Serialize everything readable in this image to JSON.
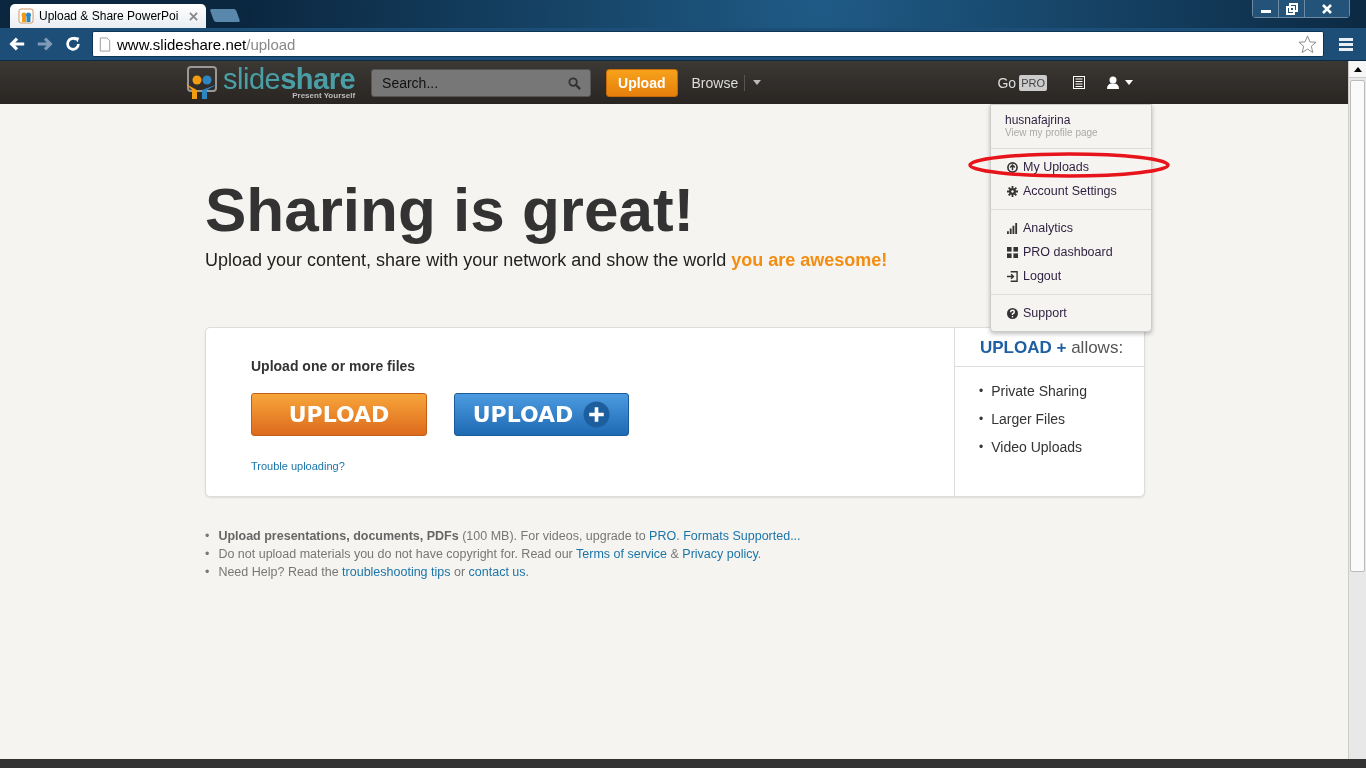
{
  "browser": {
    "tab_title": "Upload & Share PowerPoi",
    "url_host": "www.slideshare.net",
    "url_path": "/upload"
  },
  "header": {
    "logo_text": "slide**share**",
    "logo_tagline": "Present Yourself",
    "search": {
      "placeholder": "Search..."
    },
    "upload_button": "Upload",
    "browse": "Browse",
    "go": "Go",
    "pro_badge": "PRO"
  },
  "user_menu": {
    "username": "husnafajrina",
    "profile_link": "View my profile page",
    "groups": [
      [
        {
          "label": "My Uploads",
          "kind": "upload",
          "circled": true
        },
        {
          "label": "Account Settings",
          "kind": "gear",
          "circled": false
        }
      ],
      [
        {
          "label": "Analytics",
          "kind": "bars",
          "circled": false
        },
        {
          "label": "PRO dashboard",
          "kind": "grid",
          "circled": false
        },
        {
          "label": "Logout",
          "kind": "logout",
          "circled": false
        }
      ],
      [
        {
          "label": "Support",
          "kind": "help",
          "circled": false
        }
      ]
    ]
  },
  "hero": {
    "title": "Sharing is great!",
    "subtitle": "Upload your content, share with your network and show the world",
    "subtitle_highlight": "you are awesome!"
  },
  "upload_card": {
    "heading": "Upload one or more files",
    "upload_button": "UPLOAD",
    "upload_plus_button": "UPLOAD",
    "trouble_link": "Trouble uploading?",
    "plus_heading": "**UPLOAD +** allows:",
    "plus_features": [
      {
        "marker": "•",
        "text": "Private Sharing"
      },
      {
        "marker": "•",
        "text": "Larger Files"
      },
      {
        "marker": "•",
        "text": "Video Uploads"
      }
    ]
  },
  "notes": [
    [
      {
        "kind": "marker",
        "text": "•"
      },
      {
        "kind": "bold",
        "text": "Upload presentations, documents, PDFs"
      },
      {
        "kind": "plain",
        "text": " (100 MB). For videos, upgrade to "
      },
      {
        "kind": "link",
        "text": "PRO"
      },
      {
        "kind": "plain",
        "text": ". "
      },
      {
        "kind": "link",
        "text": "Formats Supported..."
      }
    ],
    [
      {
        "kind": "marker",
        "text": "•"
      },
      {
        "kind": "plain",
        "text": "Do not upload materials you do not have copyright for. Read our "
      },
      {
        "kind": "link",
        "text": "Terms of service"
      },
      {
        "kind": "plain",
        "text": " & "
      },
      {
        "kind": "link",
        "text": "Privacy policy"
      },
      {
        "kind": "plain",
        "text": "."
      }
    ],
    [
      {
        "kind": "marker",
        "text": "•"
      },
      {
        "kind": "plain",
        "text": "Need Help? Read the "
      },
      {
        "kind": "link",
        "text": "troubleshooting tips"
      },
      {
        "kind": "plain",
        "text": " or "
      },
      {
        "kind": "link",
        "text": "contact us"
      },
      {
        "kind": "plain",
        "text": "."
      }
    ]
  ]
}
